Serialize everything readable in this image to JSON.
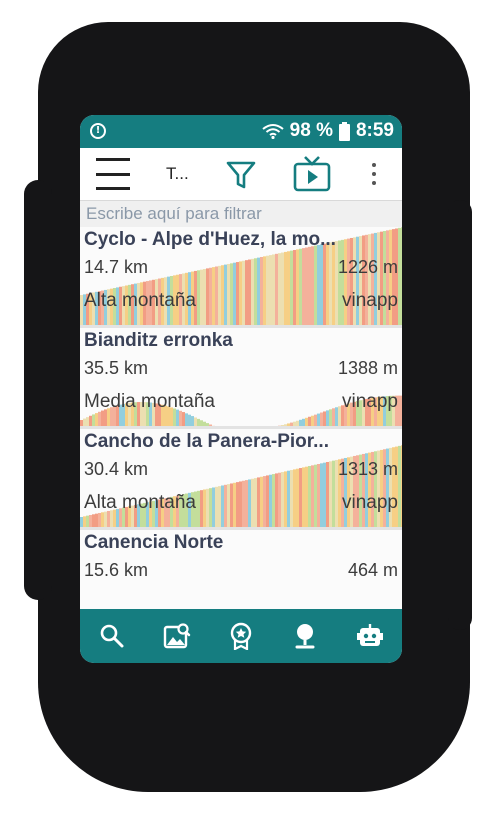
{
  "statusbar": {
    "battery": "98 %",
    "time": "8:59"
  },
  "toolbar": {
    "title": "T..."
  },
  "filter": {
    "placeholder": "Escribe aquí para filtrar"
  },
  "routes": [
    {
      "name": "Cyclo - Alpe d'Huez, la mo...",
      "distance": "14.7 km",
      "elevation": "1226 m",
      "category": "Alta montaña",
      "source": "vinapp"
    },
    {
      "name": "Bianditz erronka",
      "distance": "35.5 km",
      "elevation": "1388 m",
      "category": "Media montaña",
      "source": "vinapp"
    },
    {
      "name": "Cancho de la Panera-Pior...",
      "distance": "30.4 km",
      "elevation": "1313 m",
      "category": "Alta montaña",
      "source": "vinapp"
    },
    {
      "name": "Canencia Norte",
      "distance": "15.6 km",
      "elevation": "464 m",
      "category": "",
      "source": ""
    }
  ],
  "bottom_nav": [
    "search-icon",
    "image-search-icon",
    "award-icon",
    "map-pin-icon",
    "robot-icon"
  ],
  "colors": {
    "accent": "#157d80",
    "profile": [
      "#f08c6e",
      "#f4c770",
      "#e9d9a3",
      "#7fc6d8",
      "#b9d88a",
      "#f2a38a"
    ]
  }
}
